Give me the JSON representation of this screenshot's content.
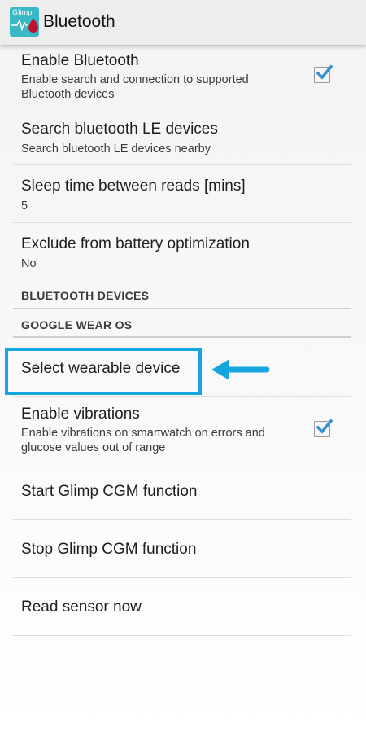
{
  "appbar": {
    "icon_text": "Glimp",
    "title": "Bluetooth"
  },
  "prefs": {
    "enable_bluetooth": {
      "title": "Enable Bluetooth",
      "summary": "Enable search and connection to supported Bluetooth devices",
      "checked": true
    },
    "search_le": {
      "title": "Search bluetooth LE devices",
      "summary": "Search bluetooth LE devices nearby"
    },
    "sleep_time": {
      "title": "Sleep time between reads [mins]",
      "summary": "5"
    },
    "exclude_battery": {
      "title": "Exclude from battery optimization",
      "summary": "No"
    },
    "select_wearable": {
      "title": "Select wearable device"
    },
    "enable_vibrations": {
      "title": "Enable vibrations",
      "summary": "Enable vibrations on smartwatch on errors and glucose values out of range",
      "checked": true
    },
    "start_cgm": {
      "title": "Start Glimp CGM function"
    },
    "stop_cgm": {
      "title": "Stop Glimp CGM function"
    },
    "read_sensor": {
      "title": "Read sensor now"
    }
  },
  "categories": {
    "bluetooth_devices": "BLUETOOTH DEVICES",
    "google_wear_os": "GOOGLE WEAR OS"
  },
  "colors": {
    "accent": "#16a6df",
    "checkbox_tick": "#3a8fd0",
    "app_icon": "#3bb8c6"
  },
  "annotation_icons": {
    "highlight": "highlight-box",
    "pointer": "arrow-left-icon"
  }
}
